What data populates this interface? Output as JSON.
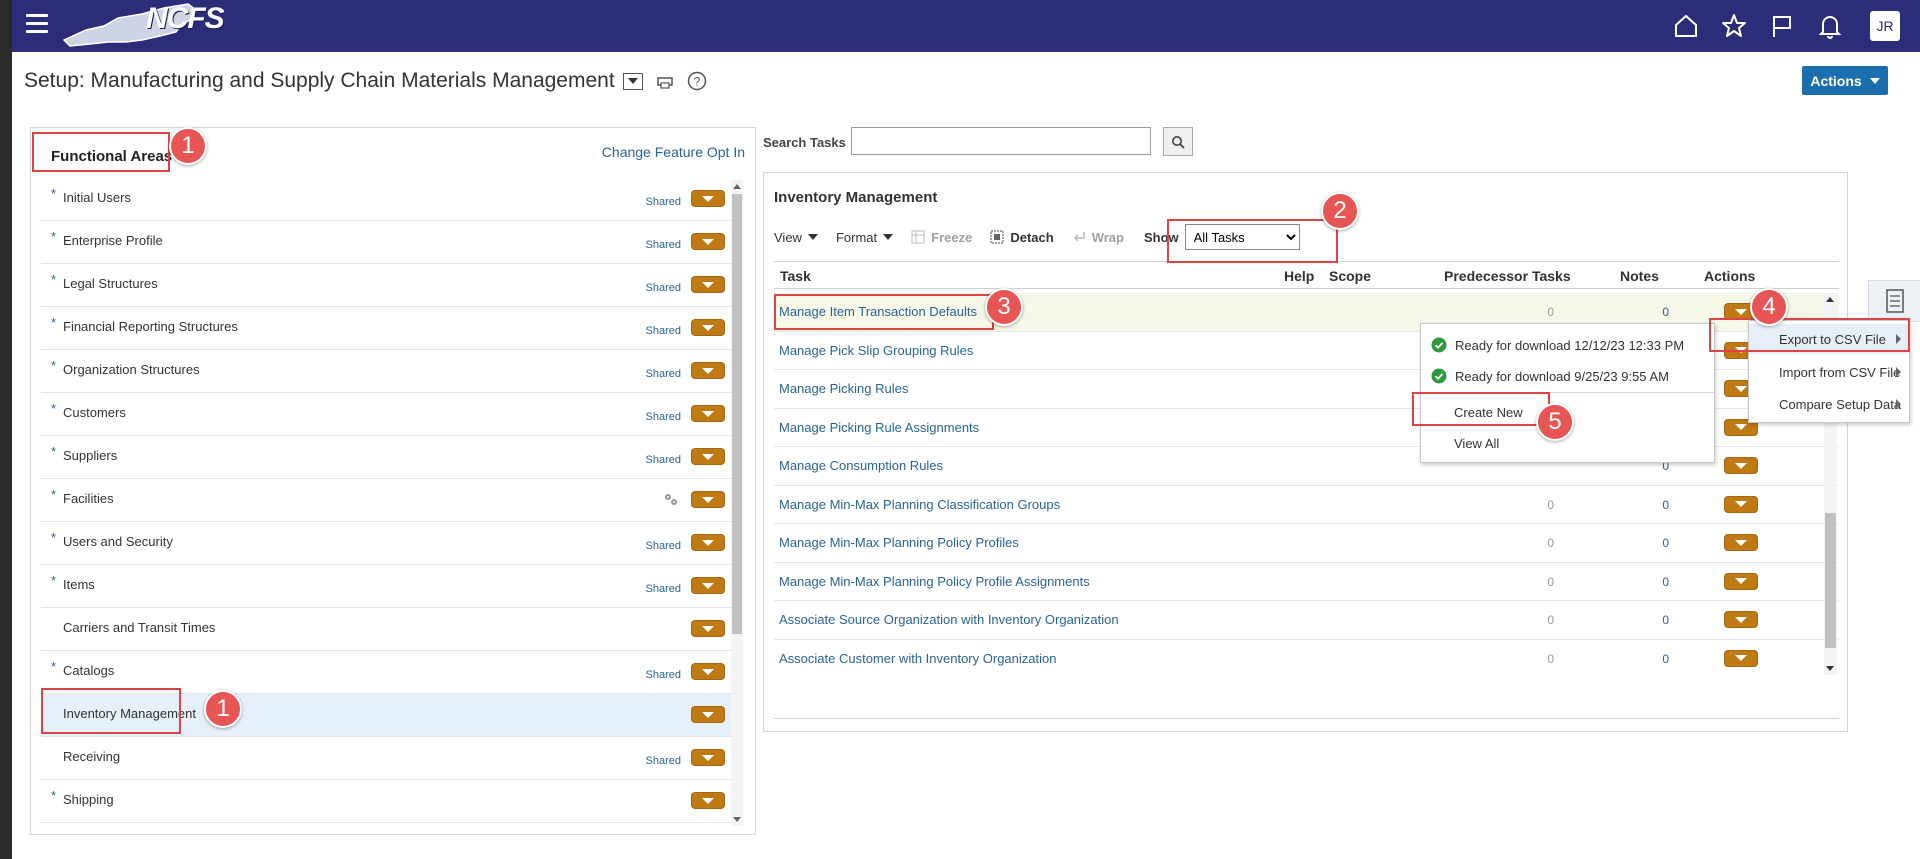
{
  "header": {
    "logo_text": "NCFS",
    "avatar_initials": "JR",
    "icons": [
      "home-icon",
      "star-icon",
      "flag-icon",
      "bell-icon"
    ]
  },
  "page": {
    "title": "Setup: Manufacturing and Supply Chain Materials Management",
    "actions_label": "Actions"
  },
  "functional_areas": {
    "header": "Functional Areas",
    "change_link": "Change Feature Opt In",
    "items": [
      {
        "label": "Initial Users",
        "required": "*",
        "shared": "Shared",
        "gear": false,
        "selected": false
      },
      {
        "label": "Enterprise Profile",
        "required": "*",
        "shared": "Shared",
        "gear": false,
        "selected": false
      },
      {
        "label": "Legal Structures",
        "required": "*",
        "shared": "Shared",
        "gear": false,
        "selected": false
      },
      {
        "label": "Financial Reporting Structures",
        "required": "*",
        "shared": "Shared",
        "gear": false,
        "selected": false
      },
      {
        "label": "Organization Structures",
        "required": "*",
        "shared": "Shared",
        "gear": false,
        "selected": false
      },
      {
        "label": "Customers",
        "required": "*",
        "shared": "Shared",
        "gear": false,
        "selected": false
      },
      {
        "label": "Suppliers",
        "required": "*",
        "shared": "Shared",
        "gear": false,
        "selected": false
      },
      {
        "label": "Facilities",
        "required": "*",
        "shared": "",
        "gear": true,
        "selected": false
      },
      {
        "label": "Users and Security",
        "required": "*",
        "shared": "Shared",
        "gear": false,
        "selected": false
      },
      {
        "label": "Items",
        "required": "*",
        "shared": "Shared",
        "gear": false,
        "selected": false
      },
      {
        "label": "Carriers and Transit Times",
        "required": "",
        "shared": "",
        "gear": false,
        "selected": false
      },
      {
        "label": "Catalogs",
        "required": "*",
        "shared": "Shared",
        "gear": false,
        "selected": false
      },
      {
        "label": "Inventory Management",
        "required": "",
        "shared": "",
        "gear": false,
        "selected": true
      },
      {
        "label": "Receiving",
        "required": "",
        "shared": "Shared",
        "gear": false,
        "selected": false
      },
      {
        "label": "Shipping",
        "required": "*",
        "shared": "",
        "gear": false,
        "selected": false
      }
    ]
  },
  "search": {
    "label": "Search Tasks",
    "value": "",
    "placeholder": ""
  },
  "tasks_panel": {
    "title": "Inventory Management",
    "toolbar": {
      "view": "View",
      "format": "Format",
      "freeze": "Freeze",
      "detach": "Detach",
      "wrap": "Wrap",
      "show_label": "Show",
      "show_value": "All Tasks"
    },
    "columns": {
      "task": "Task",
      "help": "Help",
      "scope": "Scope",
      "predecessor": "Predecessor Tasks",
      "notes": "Notes",
      "actions": "Actions"
    },
    "rows": [
      {
        "task": "Manage Item Transaction Defaults",
        "pred": "0",
        "notes": "0"
      },
      {
        "task": "Manage Pick Slip Grouping Rules",
        "pred": "",
        "notes": ""
      },
      {
        "task": "Manage Picking Rules",
        "pred": "",
        "notes": ""
      },
      {
        "task": "Manage Picking Rule Assignments",
        "pred": "",
        "notes": ""
      },
      {
        "task": "Manage Consumption Rules",
        "pred": "",
        "notes": "0"
      },
      {
        "task": "Manage Min-Max Planning Classification Groups",
        "pred": "0",
        "notes": "0"
      },
      {
        "task": "Manage Min-Max Planning Policy Profiles",
        "pred": "0",
        "notes": "0"
      },
      {
        "task": "Manage Min-Max Planning Policy Profile Assignments",
        "pred": "0",
        "notes": "0"
      },
      {
        "task": "Associate Source Organization with Inventory Organization",
        "pred": "0",
        "notes": "0"
      },
      {
        "task": "Associate Customer with Inventory Organization",
        "pred": "0",
        "notes": "0"
      }
    ]
  },
  "download_menu": {
    "items": [
      {
        "label": "Ready for download 12/12/23 12:33 PM"
      },
      {
        "label": "Ready for download 9/25/23 9:55 AM"
      }
    ],
    "create_new": "Create New",
    "view_all": "View All"
  },
  "actions_menu": {
    "items": [
      "Export to CSV File",
      "Import from CSV File",
      "Compare Setup Data"
    ]
  },
  "annotations": {
    "one": "1",
    "two": "2",
    "three": "3",
    "four": "4",
    "five": "5"
  },
  "colors": {
    "topbar": "#2c2d78",
    "accent_button": "#1b6fae",
    "orange_button": "#c07a13",
    "link": "#2a6496",
    "highlight": "#e04343",
    "badge": "#e85555"
  }
}
